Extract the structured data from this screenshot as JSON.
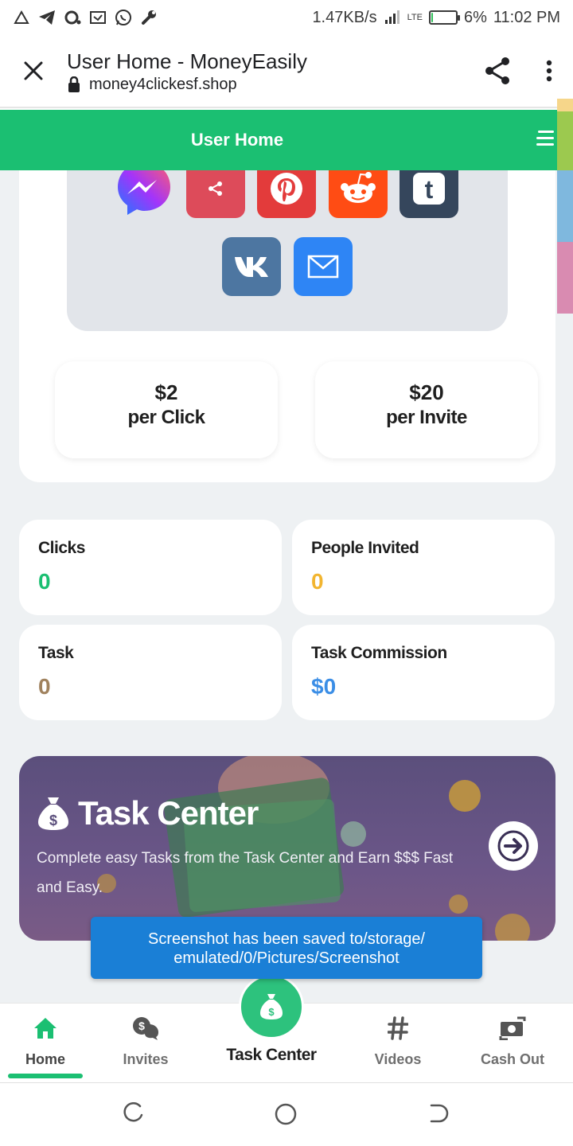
{
  "status_bar": {
    "network_speed": "1.47KB/s",
    "network_type": "LTE",
    "battery_percent": "6%",
    "battery_level": 0.06,
    "time": "11:02 PM",
    "left_icons": [
      "alert-triangle-icon",
      "telegram-icon",
      "notification-icon",
      "cast-icon",
      "whatsapp-icon",
      "wrench-icon"
    ]
  },
  "browser": {
    "page_title": "User Home - MoneyEasily",
    "url": "money4clickesf.shop"
  },
  "app_header": {
    "title": "User Home"
  },
  "share_icons": [
    "messenger-icon",
    "share-icon",
    "pinterest-icon",
    "reddit-icon",
    "tumblr-icon",
    "vk-icon",
    "email-icon"
  ],
  "rates": [
    {
      "amount": "$2",
      "label": "per Click"
    },
    {
      "amount": "$20",
      "label": "per Invite"
    }
  ],
  "metrics": [
    {
      "label": "Clicks",
      "value": "0",
      "color": "#1bbf72"
    },
    {
      "label": "People Invited",
      "value": "0",
      "color": "#f2b530"
    },
    {
      "label": "Task",
      "value": "0",
      "color": "#a0825e"
    },
    {
      "label": "Task Commission",
      "value": "$0",
      "color": "#3b8ee6"
    }
  ],
  "task_banner": {
    "title": "Task Center",
    "description": "Complete easy Tasks from the Task Center and Earn $$$ Fast and Easy."
  },
  "toast": {
    "line1": "Screenshot has been saved to/storage/",
    "line2": "emulated/0/Pictures/Screenshot"
  },
  "bottom_nav": {
    "home": "Home",
    "invites": "Invites",
    "task_center": "Task Center",
    "videos": "Videos",
    "cash_out": "Cash Out"
  },
  "colors": {
    "brand_green": "#1bbf72",
    "toast_blue": "#1a7fd6"
  }
}
